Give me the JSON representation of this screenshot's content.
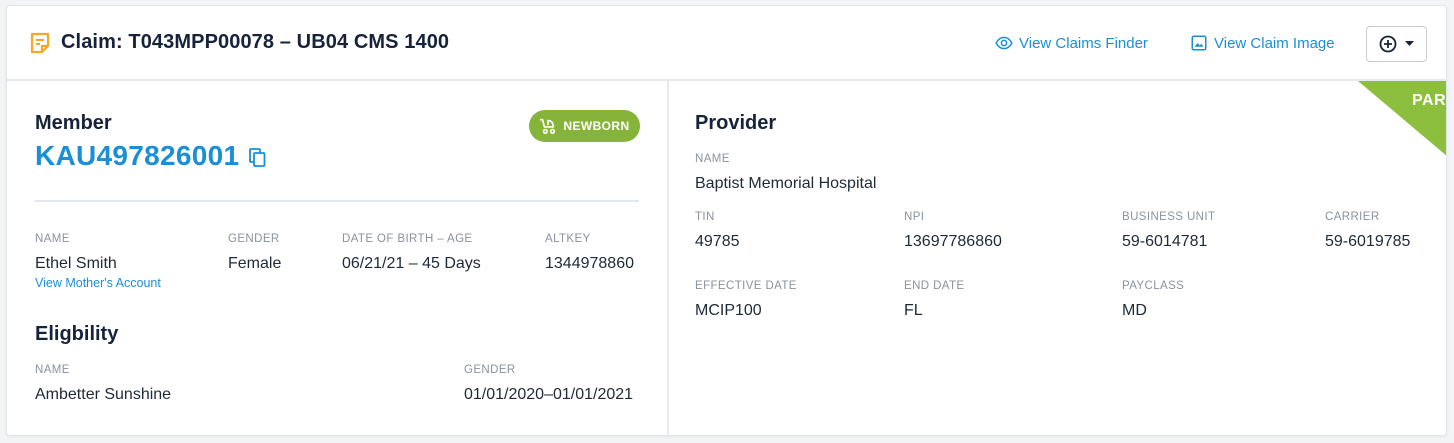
{
  "header": {
    "title": "Claim: T043MPP00078 – UB04 CMS 1400",
    "claims_finder_label": "View Claims Finder",
    "claim_image_label": "View Claim Image"
  },
  "member": {
    "section_title": "Member",
    "member_id": "KAU497826001",
    "badge_label": "NEWBORN",
    "fields": {
      "name_label": "NAME",
      "name_value": "Ethel Smith",
      "mother_link": "View Mother's Account",
      "gender_label": "GENDER",
      "gender_value": "Female",
      "dob_label": "DATE OF BIRTH – AGE",
      "dob_value": "06/21/21 – 45 Days",
      "altkey_label": "ALTKEY",
      "altkey_value": "1344978860"
    }
  },
  "eligibility": {
    "section_title": "Eligbility",
    "name_label": "NAME",
    "name_value": "Ambetter Sunshine",
    "gender_label": "GENDER",
    "gender_value": "01/01/2020–01/01/2021"
  },
  "provider": {
    "section_title": "Provider",
    "ribbon_label": "PAR",
    "name_label": "NAME",
    "name_value": "Baptist Memorial Hospital",
    "tin_label": "TIN",
    "tin_value": "49785",
    "npi_label": "NPI",
    "npi_value": "13697786860",
    "business_unit_label": "BUSINESS UNIT",
    "business_unit_value": "59-6014781",
    "carrier_label": "CARRIER",
    "carrier_value": "59-6019785",
    "effective_date_label": "EFFECTIVE DATE",
    "effective_date_value": "MCIP100",
    "end_date_label": "END DATE",
    "end_date_value": "FL",
    "payclass_label": "PAYCLASS",
    "payclass_value": "MD"
  },
  "colors": {
    "accent_blue": "#1a8fd6",
    "newborn_green": "#86b33a",
    "ribbon_green": "#8dbf3e",
    "claim_icon_orange": "#f5a623",
    "title_navy": "#16233a"
  },
  "icons": {
    "claim": "note-icon",
    "finder": "eye-icon",
    "image": "image-icon",
    "add": "plus-circle-icon",
    "dropdown": "caret-down-icon",
    "copy": "copy-icon",
    "newborn": "stroller-icon"
  }
}
